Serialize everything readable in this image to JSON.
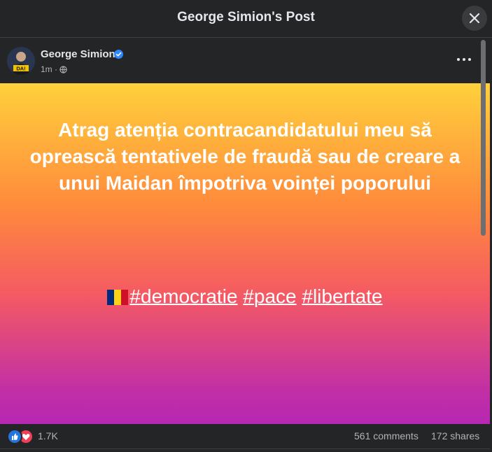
{
  "dialog": {
    "title": "George Simion's Post"
  },
  "post": {
    "author": "George Simion",
    "time": "1m",
    "separator": "·",
    "text": "Atrag atenția contracandidatului meu să oprească tentativele de fraudă sau de creare a unui Maidan împotriva voinței poporului",
    "hashtags": [
      "#democratie",
      "#pace",
      "#libertate"
    ],
    "avatar_badge": "DA!",
    "gradient_colors": [
      "#ffd03c",
      "#ff8a3c",
      "#f45a63",
      "#b727b2"
    ]
  },
  "stats": {
    "reactions_count": "1.7K",
    "comments": "561 comments",
    "shares": "172 shares"
  },
  "icons": {
    "close": "close-icon",
    "verified": "verified-badge-icon",
    "privacy": "globe-icon",
    "more": "more-options-icon",
    "like": "like-reaction-icon",
    "love": "love-reaction-icon",
    "flag": "romania-flag-icon"
  },
  "colors": {
    "background": "#242526",
    "text_primary": "#e4e6eb",
    "text_secondary": "#b0b3b8",
    "verified_blue": "#2d88ff",
    "like_blue": "#2374e1",
    "love_red": "#f33e58"
  }
}
